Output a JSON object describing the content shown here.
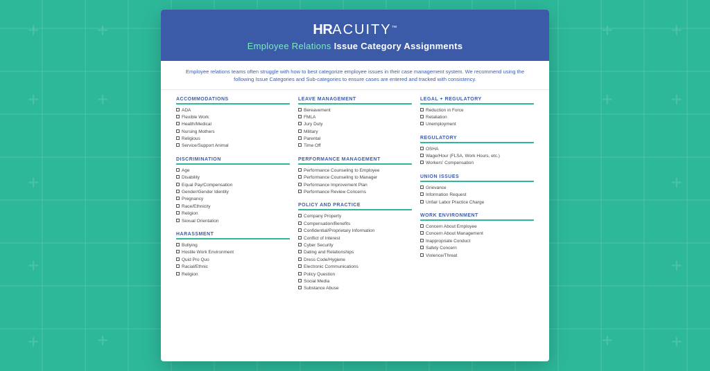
{
  "header": {
    "logo_hr": "HR",
    "logo_acuity": "ACUITY",
    "logo_tm": "™",
    "subtitle_green": "Employee Relations",
    "subtitle_white": "Issue Category Assignments"
  },
  "intro": {
    "text": "Employee relations teams often struggle with how to best categorize employee issues in their case management system. We recommend using the following Issue Categories and Sub-categories to ensure cases are entered and tracked with consistency."
  },
  "columns": [
    {
      "id": "col1",
      "sections": [
        {
          "title": "ACCOMMODATIONS",
          "items": [
            "ADA",
            "Flexible Work",
            "Health/Medical",
            "Nursing Mothers",
            "Religious",
            "Service/Support Animal"
          ]
        },
        {
          "title": "DISCRIMINATION",
          "items": [
            "Age",
            "Disability",
            "Equal Pay/Compensation",
            "Gender/Gender Identity",
            "Pregnancy",
            "Race/Ethnicity",
            "Religion",
            "Sexual Orientation"
          ]
        },
        {
          "title": "HARASSMENT",
          "items": [
            "Bullying",
            "Hostile Work Environment",
            "Quid Pro Quo",
            "Racial/Ethnic",
            "Religion"
          ]
        }
      ]
    },
    {
      "id": "col2",
      "sections": [
        {
          "title": "LEAVE MANAGEMENT",
          "items": [
            "Bereavement",
            "FMLA",
            "Jury Duty",
            "Military",
            "Parental",
            "Time Off"
          ]
        },
        {
          "title": "PERFORMANCE MANAGEMENT",
          "items": [
            "Performance Counseling to Employee",
            "Performance Counseling to Manager",
            "Performance Improvement Plan",
            "Performance Review Concerns"
          ]
        },
        {
          "title": "POLICY AND PRACTICE",
          "items": [
            "Company Property",
            "Compensation/Benefits",
            "Confidential/Proprietary Information",
            "Conflict of Interest",
            "Cyber Security",
            "Dating and Relationships",
            "Dress Code/Hygiene",
            "Electronic Communications",
            "Policy Question",
            "Social Media",
            "Substance Abuse"
          ]
        }
      ]
    },
    {
      "id": "col3",
      "sections": [
        {
          "title": "LEGAL + REGULATORY",
          "items": [
            "Reduction in Force",
            "Retaliation",
            "Unemployment"
          ]
        },
        {
          "title": "REGULATORY",
          "items": [
            "OSHA",
            "Wage/Hour (FLSA, Work Hours, etc.)",
            "Workers' Compensation"
          ]
        },
        {
          "title": "UNION ISSUES",
          "items": [
            "Grievance",
            "Information Request",
            "Unfair Labor Practice Charge"
          ]
        },
        {
          "title": "WORK ENVIRONMENT",
          "items": [
            "Concern About Employee",
            "Concern About Management",
            "Inappropriate Conduct",
            "Safety Concern",
            "Violence/Threat"
          ]
        }
      ]
    }
  ]
}
